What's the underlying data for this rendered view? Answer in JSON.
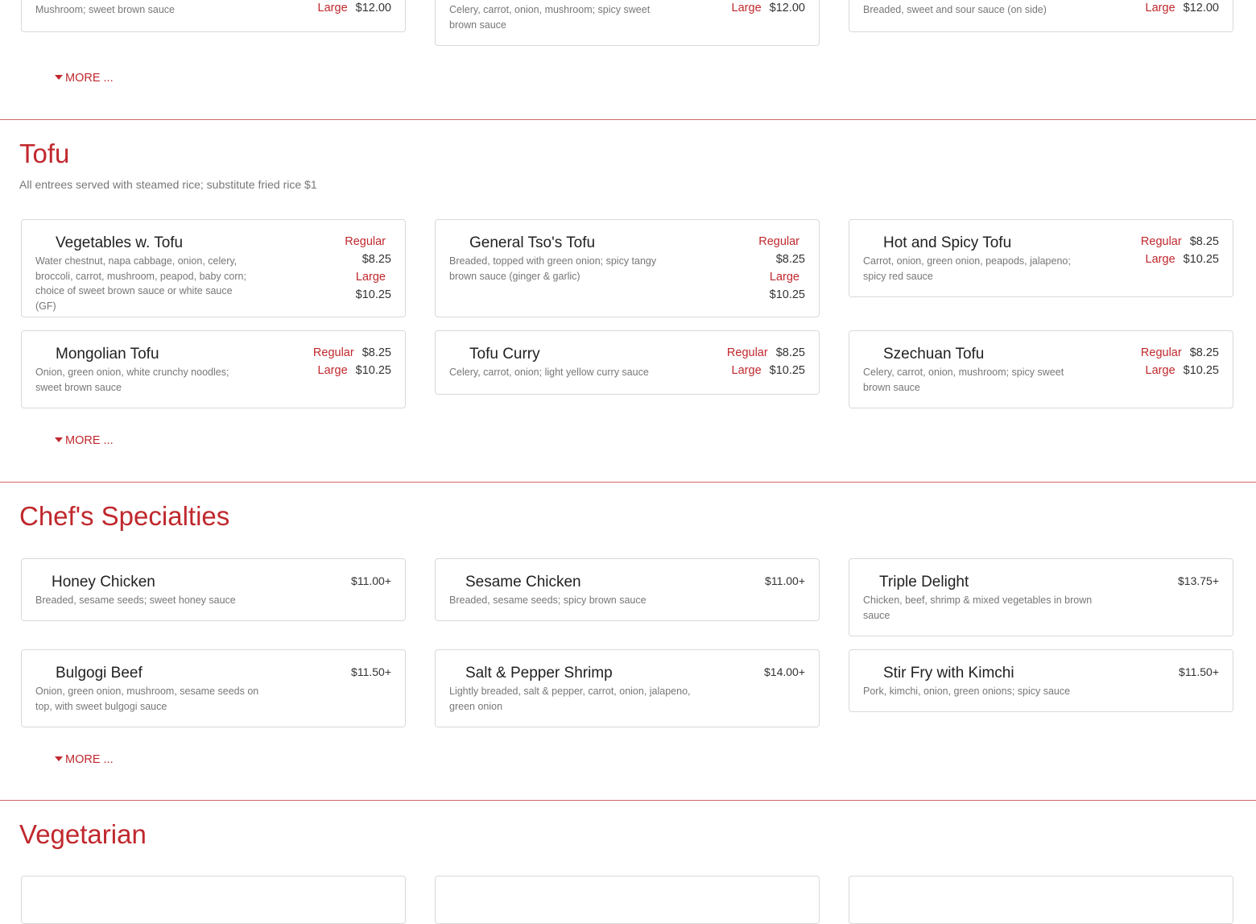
{
  "colors": {
    "accent": "#c0282d",
    "border": "#d9d9d9",
    "muted": "#777777",
    "text": "#212121"
  },
  "top": {
    "items": [
      {
        "desc": "Mushroom; sweet brown sauce",
        "size": "Large",
        "price": "$12.00"
      },
      {
        "desc": "Celery, carrot, onion, mushroom; spicy sweet brown sauce",
        "size": "Large",
        "price": "$12.00"
      },
      {
        "desc": "Breaded, sweet and sour sauce (on side)",
        "size": "Large",
        "price": "$12.00"
      }
    ],
    "more": "MORE ..."
  },
  "tofu": {
    "title": "Tofu",
    "note": "All entrees served with steamed rice; substitute fried rice $1",
    "more": "MORE ...",
    "items": [
      {
        "name": "Vegetables w. Tofu",
        "desc": "Water chestnut, napa cabbage, onion, celery, broccoli, carrot, mushroom, peapod, baby corn; choice of sweet brown sauce or white sauce (GF)",
        "regular_label": "Regular",
        "regular": "$8.25",
        "large_label": "Large",
        "large": "$10.25"
      },
      {
        "name": "General Tso's Tofu",
        "desc": "Breaded, topped with green onion; spicy tangy brown sauce (ginger & garlic)",
        "regular_label": "Regular",
        "regular": "$8.25",
        "large_label": "Large",
        "large": "$10.25"
      },
      {
        "name": "Hot and Spicy Tofu",
        "desc": "Carrot, onion, green onion, peapods, jalapeno; spicy red sauce",
        "regular_label": "Regular",
        "regular": "$8.25",
        "large_label": "Large",
        "large": "$10.25"
      },
      {
        "name": "Mongolian Tofu",
        "desc": "Onion, green onion, white crunchy noodles; sweet brown sauce",
        "regular_label": "Regular",
        "regular": "$8.25",
        "large_label": "Large",
        "large": "$10.25"
      },
      {
        "name": "Tofu Curry",
        "desc": "Celery, carrot, onion; light yellow curry sauce",
        "regular_label": "Regular",
        "regular": "$8.25",
        "large_label": "Large",
        "large": "$10.25"
      },
      {
        "name": "Szechuan Tofu",
        "desc": "Celery, carrot, onion, mushroom; spicy sweet brown sauce",
        "regular_label": "Regular",
        "regular": "$8.25",
        "large_label": "Large",
        "large": "$10.25"
      }
    ]
  },
  "chefs": {
    "title": "Chef's Specialties",
    "more": "MORE ...",
    "items": [
      {
        "name": "Honey Chicken",
        "desc": "Breaded, sesame seeds; sweet honey sauce",
        "price": "$11.00+"
      },
      {
        "name": "Sesame Chicken",
        "desc": "Breaded, sesame seeds; spicy brown sauce",
        "price": "$11.00+"
      },
      {
        "name": "Triple Delight",
        "desc": "Chicken, beef, shrimp & mixed vegetables in brown sauce",
        "price": "$13.75+"
      },
      {
        "name": "Bulgogi Beef",
        "desc": "Onion, green onion, mushroom, sesame seeds on top, with sweet bulgogi sauce",
        "price": "$11.50+"
      },
      {
        "name": "Salt & Pepper Shrimp",
        "desc": "Lightly breaded, salt & pepper, carrot, onion, jalapeno, green onion",
        "price": "$14.00+"
      },
      {
        "name": "Stir Fry with Kimchi",
        "desc": "Pork, kimchi, onion, green onions; spicy sauce",
        "price": "$11.50+"
      }
    ]
  },
  "vegetarian": {
    "title": "Vegetarian"
  }
}
